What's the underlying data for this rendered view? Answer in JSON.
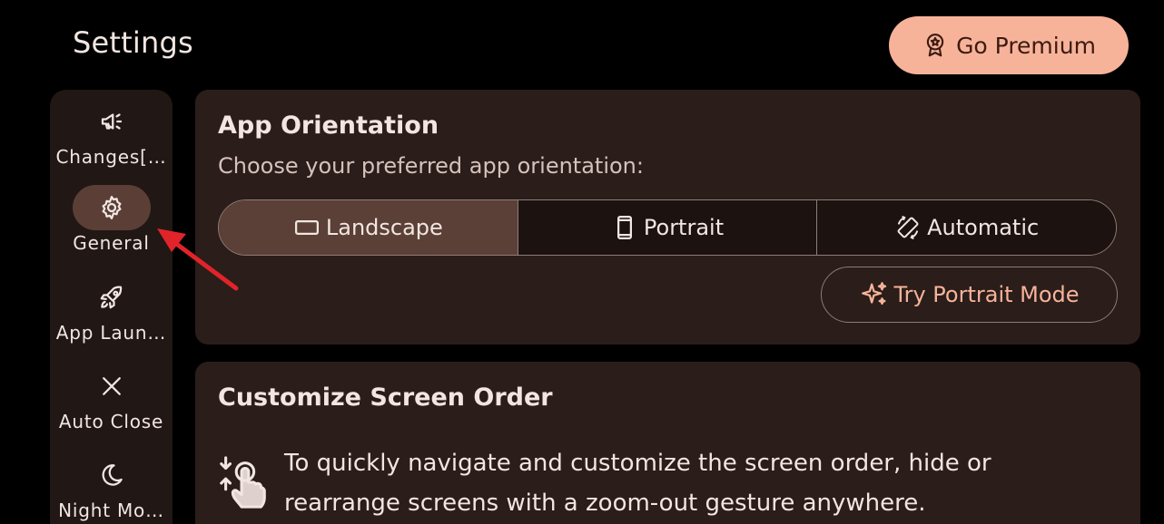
{
  "header": {
    "title": "Settings",
    "premium_label": "Go Premium"
  },
  "sidebar": {
    "items": [
      {
        "label": "Changes[…",
        "icon": "megaphone-icon",
        "active": false
      },
      {
        "label": "General",
        "icon": "gear-icon",
        "active": true
      },
      {
        "label": "App Laun…",
        "icon": "rocket-icon",
        "active": false
      },
      {
        "label": "Auto Close",
        "icon": "close-icon",
        "active": false
      },
      {
        "label": "Night Mo…",
        "icon": "moon-icon",
        "active": false
      }
    ]
  },
  "orientation": {
    "title": "App Orientation",
    "subtitle": "Choose your preferred app orientation:",
    "options": [
      {
        "label": "Landscape",
        "icon": "landscape-icon",
        "selected": true
      },
      {
        "label": "Portrait",
        "icon": "portrait-icon",
        "selected": false
      },
      {
        "label": "Automatic",
        "icon": "auto-rotate-icon",
        "selected": false
      }
    ],
    "try_label": "Try Portrait Mode"
  },
  "screen_order": {
    "title": "Customize Screen Order",
    "description": "To quickly navigate and customize the screen order, hide or rearrange screens with a zoom-out gesture anywhere."
  },
  "colors": {
    "background": "#000000",
    "card": "#2a1d1a",
    "accent": "#f7b39a",
    "selected_segment": "#5b4037",
    "annotation_arrow": "#e0242a"
  }
}
